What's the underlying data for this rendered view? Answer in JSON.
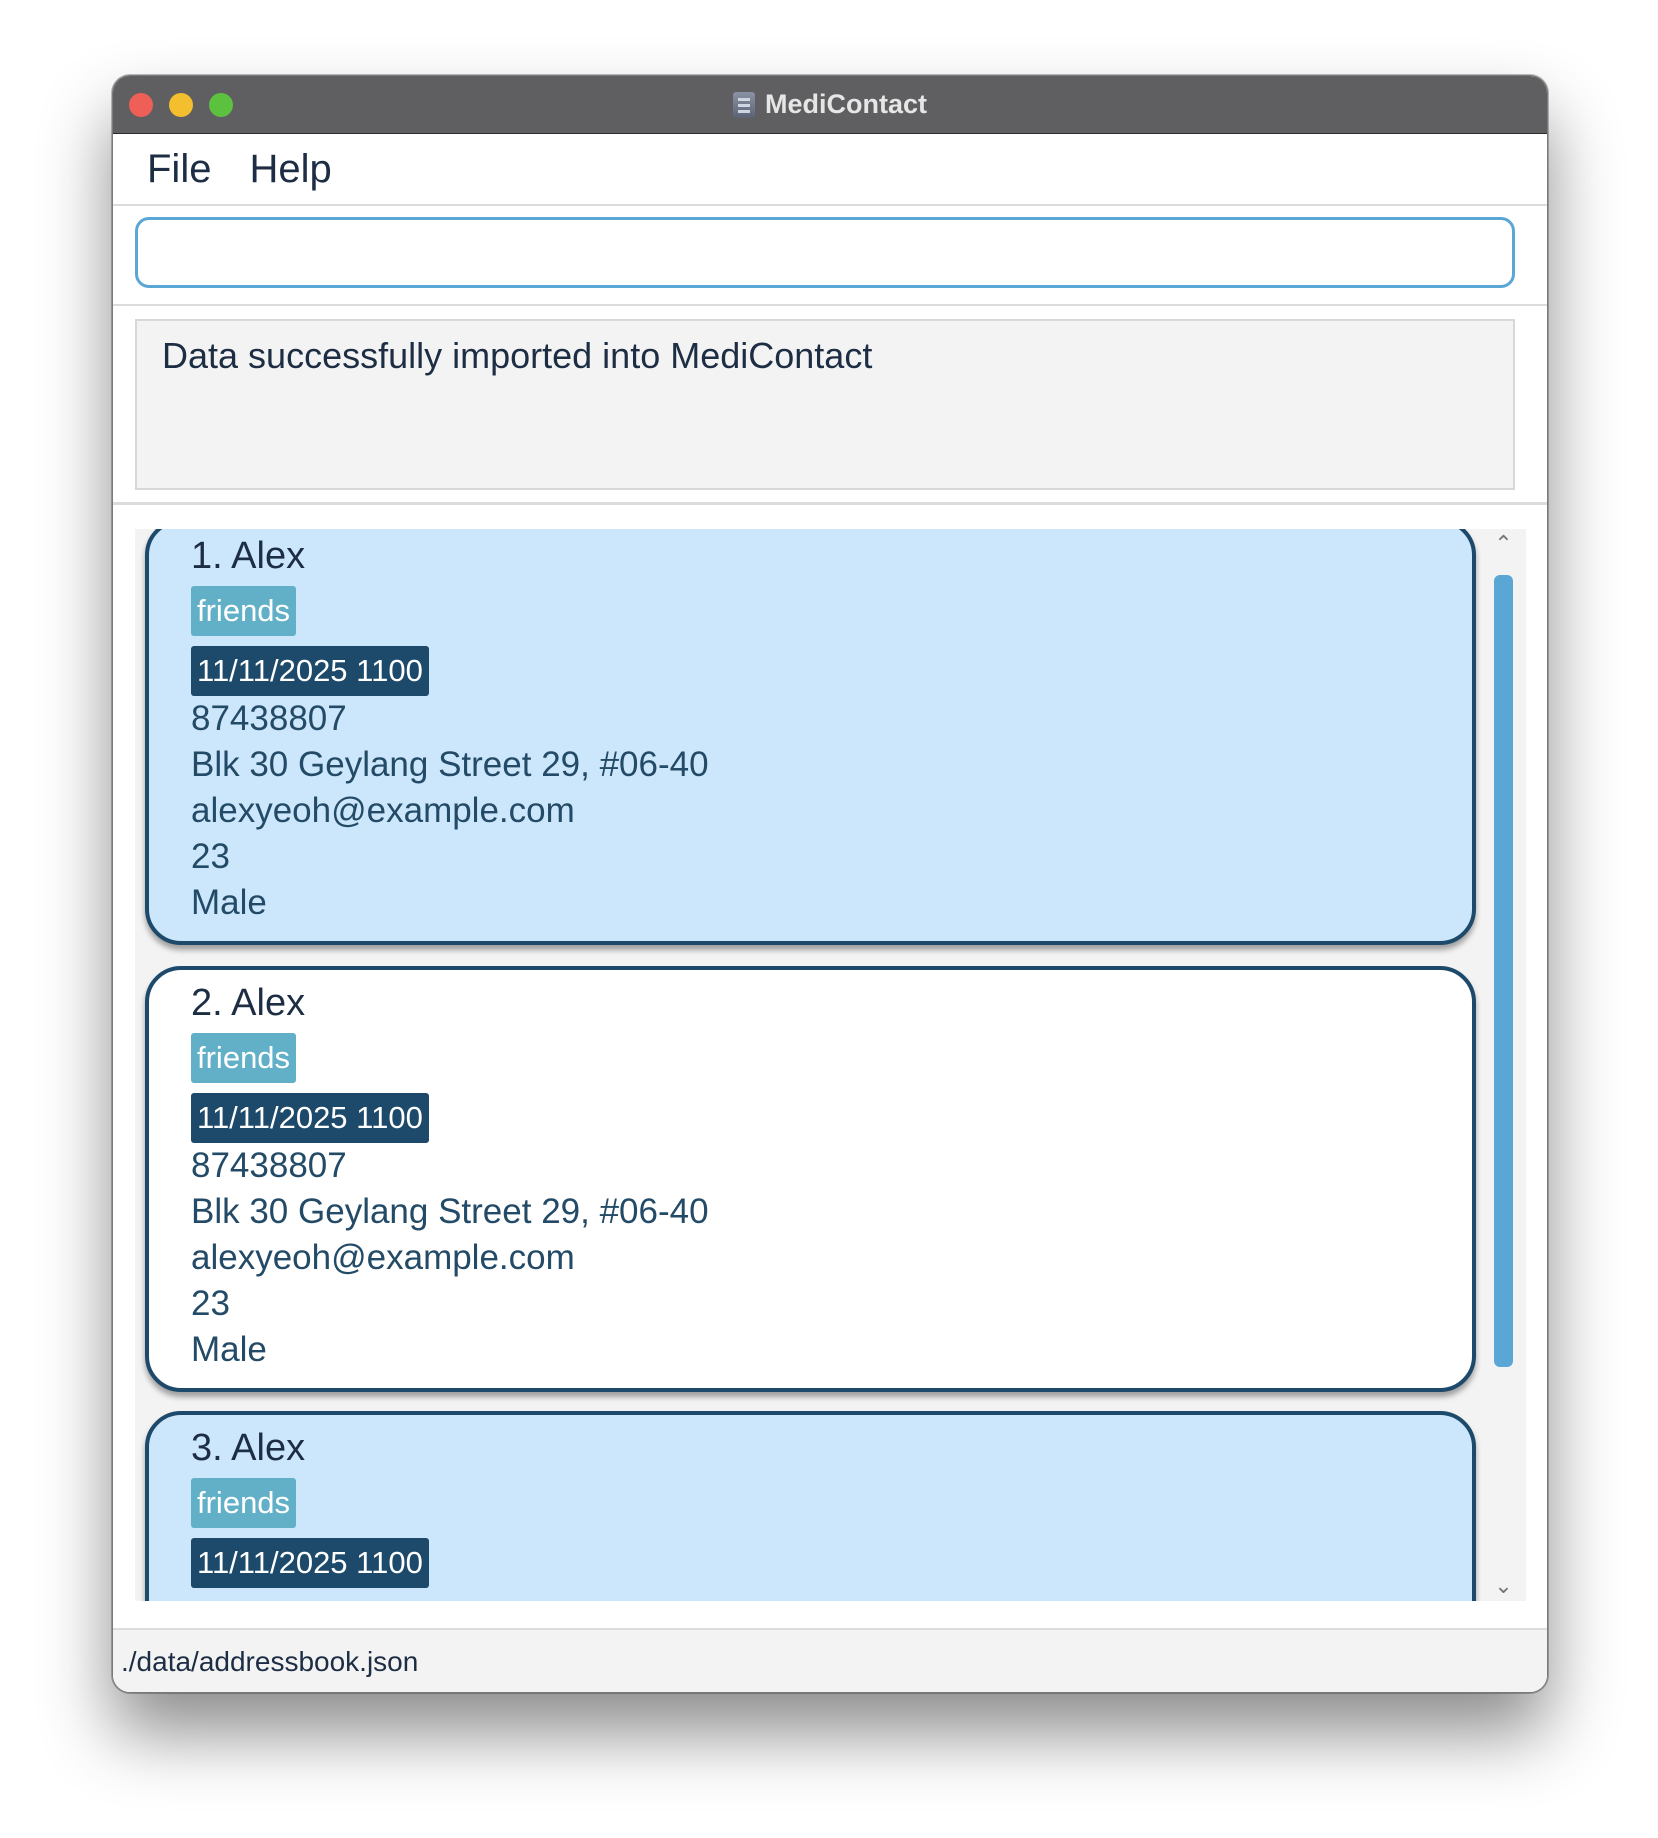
{
  "window": {
    "title": "MediContact"
  },
  "menu": {
    "file": "File",
    "help": "Help"
  },
  "command": {
    "value": "",
    "placeholder": ""
  },
  "result": {
    "message": "Data successfully imported into MediContact"
  },
  "persons": [
    {
      "name": "1. Alex",
      "tag": "friends",
      "appointment": "11/11/2025 1100",
      "phone": "87438807",
      "address": "Blk 30 Geylang Street 29, #06-40",
      "email": "alexyeoh@example.com",
      "age": "23",
      "sex": "Male"
    },
    {
      "name": "2. Alex",
      "tag": "friends",
      "appointment": "11/11/2025 1100",
      "phone": "87438807",
      "address": "Blk 30 Geylang Street 29, #06-40",
      "email": "alexyeoh@example.com",
      "age": "23",
      "sex": "Male"
    },
    {
      "name": "3. Alex",
      "tag": "friends",
      "appointment": "11/11/2025 1100"
    }
  ],
  "scrollbar": {
    "up_icon": "chevron-up-icon",
    "down_icon": "chevron-down-icon"
  },
  "status": {
    "path": "./data/addressbook.json"
  },
  "colors": {
    "selected_card": "#cce7fb",
    "card_border": "#1d4a6b",
    "tag": "#62b0c7",
    "appointment": "#1d4a6b",
    "accent": "#5aa7d6"
  }
}
